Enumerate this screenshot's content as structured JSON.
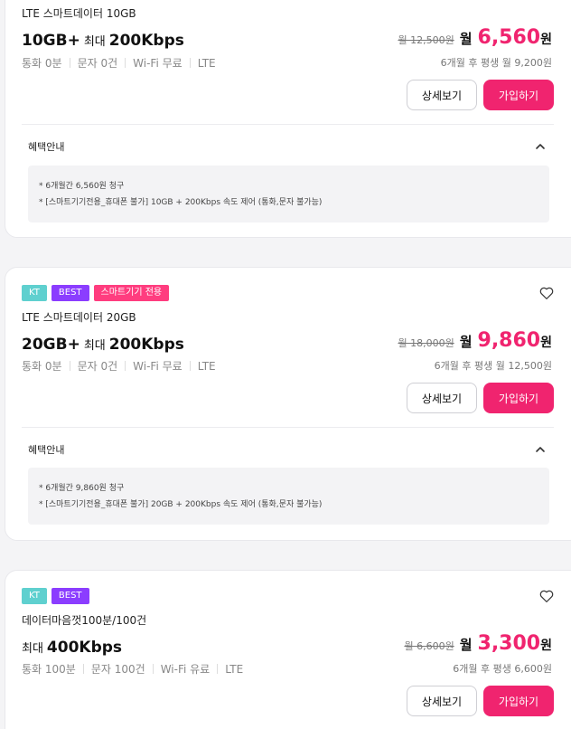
{
  "colors": {
    "accent": "#f0246f",
    "tag_kt": "#5fd0cf",
    "tag_best": "#8b3dff",
    "tag_smart": "#ff3d7f"
  },
  "plans": [
    {
      "name": "LTE 스마트데이터 10GB",
      "headline_main": "10GB+",
      "headline_sub": "최대",
      "headline_speed": "200Kbps",
      "specs": [
        "통화 0분",
        "문자 0건",
        "Wi-Fi 무료",
        "LTE"
      ],
      "old_price": "월 12,500원",
      "month_label": "월",
      "price": "6,560",
      "won": "원",
      "after_price": "6개월 후 평생 월 9,200원",
      "detail_label": "상세보기",
      "join_label": "가입하기",
      "benefit_title": "혜택안내",
      "benefits": [
        "* 6개월간 6,560원 청구",
        "* [스마트기기전용_휴대폰 불가] 10GB + 200Kbps 속도 제어 (통화,문자 불가능)"
      ]
    },
    {
      "tags": [
        "KT",
        "BEST",
        "스마트기기 전용"
      ],
      "name": "LTE 스마트데이터 20GB",
      "headline_main": "20GB+",
      "headline_sub": "최대",
      "headline_speed": "200Kbps",
      "specs": [
        "통화 0분",
        "문자 0건",
        "Wi-Fi 무료",
        "LTE"
      ],
      "old_price": "월 18,000원",
      "month_label": "월",
      "price": "9,860",
      "won": "원",
      "after_price": "6개월 후 평생 월 12,500원",
      "detail_label": "상세보기",
      "join_label": "가입하기",
      "benefit_title": "혜택안내",
      "benefits": [
        "* 6개월간 9,860원 청구",
        "* [스마트기기전용_휴대폰 불가] 20GB + 200Kbps 속도 제어 (통화,문자 불가능)"
      ]
    },
    {
      "tags": [
        "KT",
        "BEST"
      ],
      "name": "데이터마음껏100분/100건",
      "headline_sub": "최대",
      "headline_speed": "400Kbps",
      "specs": [
        "통화 100분",
        "문자 100건",
        "Wi-Fi 유료",
        "LTE"
      ],
      "old_price": "월 6,600원",
      "month_label": "월",
      "price": "3,300",
      "won": "원",
      "after_price": "6개월 후 평생 6,600원",
      "detail_label": "상세보기",
      "join_label": "가입하기"
    }
  ]
}
